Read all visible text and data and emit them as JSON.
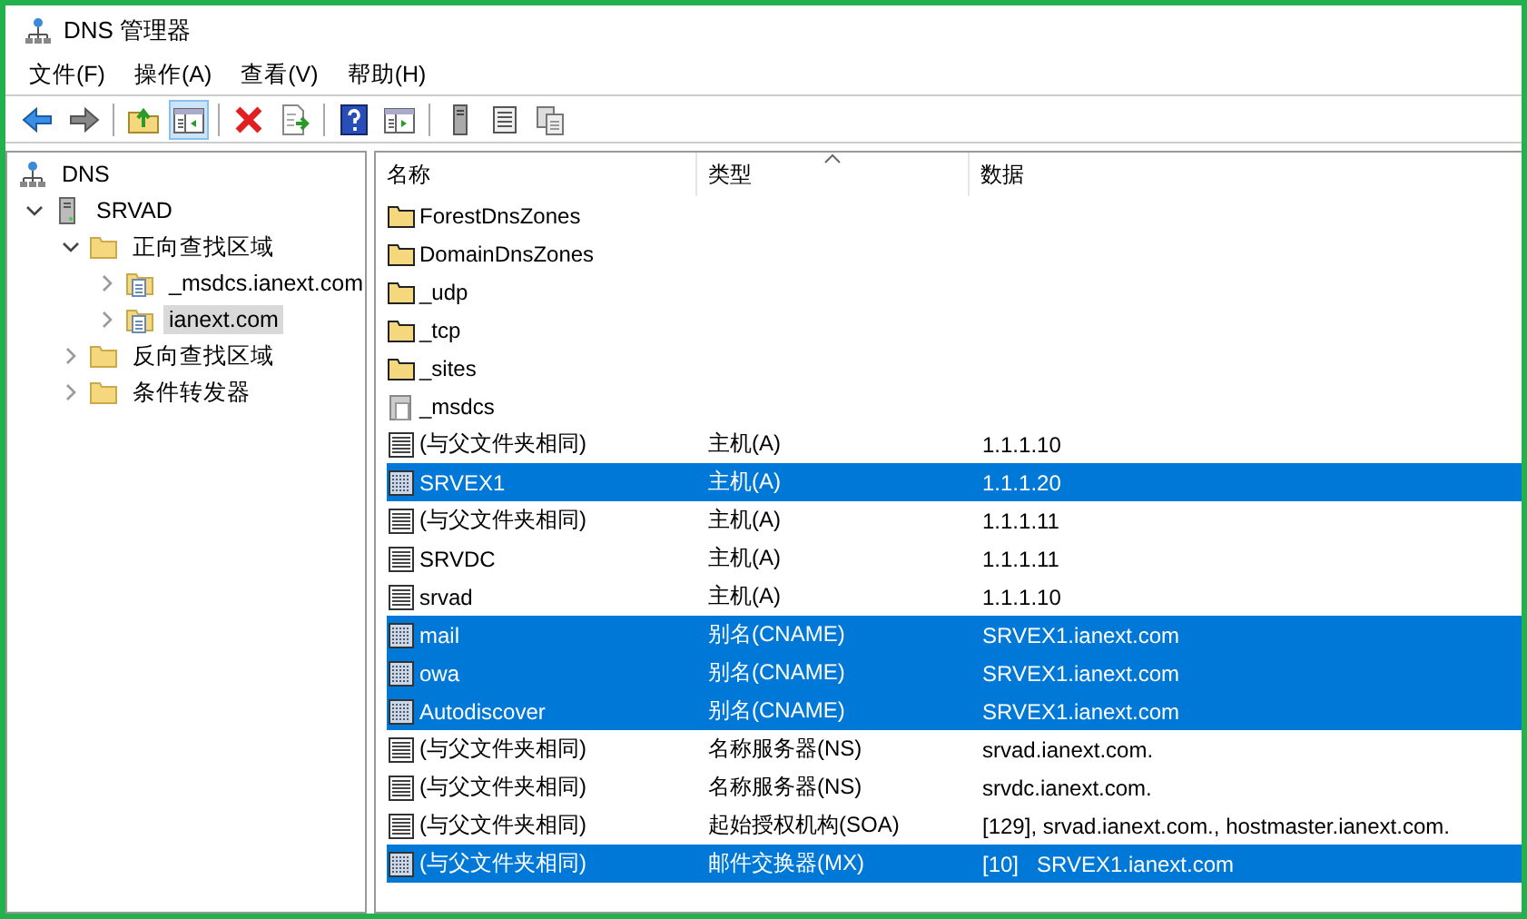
{
  "window": {
    "title": "DNS 管理器"
  },
  "menu": [
    "文件(F)",
    "操作(A)",
    "查看(V)",
    "帮助(H)"
  ],
  "toolbar": [
    {
      "kind": "back",
      "selected": false
    },
    {
      "kind": "forward",
      "selected": false
    },
    {
      "kind": "sep"
    },
    {
      "kind": "up",
      "selected": false
    },
    {
      "kind": "pane",
      "selected": true
    },
    {
      "kind": "sep"
    },
    {
      "kind": "delete",
      "selected": false
    },
    {
      "kind": "export",
      "selected": false
    },
    {
      "kind": "sep"
    },
    {
      "kind": "help",
      "selected": false
    },
    {
      "kind": "panel",
      "selected": false
    },
    {
      "kind": "sep"
    },
    {
      "kind": "server",
      "selected": false
    },
    {
      "kind": "list",
      "selected": false
    },
    {
      "kind": "copy",
      "selected": false
    }
  ],
  "tree": [
    {
      "label": "DNS",
      "kind": "root",
      "selected": false,
      "children": [
        {
          "label": "SRVAD",
          "kind": "server",
          "selected": false,
          "expanded": true,
          "children": [
            {
              "label": "正向查找区域",
              "kind": "folder",
              "selected": false,
              "expanded": true,
              "children": [
                {
                  "label": "_msdcs.ianext.com",
                  "kind": "zone",
                  "selected": false,
                  "expanded": false
                },
                {
                  "label": "ianext.com",
                  "kind": "zone",
                  "selected": true,
                  "expanded": false
                }
              ]
            },
            {
              "label": "反向查找区域",
              "kind": "folder",
              "selected": false,
              "expanded": false
            },
            {
              "label": "条件转发器",
              "kind": "folder",
              "selected": false,
              "expanded": false
            }
          ]
        }
      ]
    }
  ],
  "table": {
    "columns": [
      {
        "label": "名称",
        "sorted": false
      },
      {
        "label": "类型",
        "sorted": true
      },
      {
        "label": "数据",
        "sorted": false
      }
    ],
    "rows": [
      {
        "kind": "folder",
        "name": "ForestDnsZones",
        "selected": false
      },
      {
        "kind": "folder",
        "name": "DomainDnsZones",
        "selected": false
      },
      {
        "kind": "folder",
        "name": "_udp",
        "selected": false
      },
      {
        "kind": "folder",
        "name": "_tcp",
        "selected": false
      },
      {
        "kind": "folder",
        "name": "_sites",
        "selected": false
      },
      {
        "kind": "zone",
        "name": "_msdcs",
        "selected": false
      },
      {
        "kind": "record",
        "name": "(与父文件夹相同)",
        "type": "主机(A)",
        "data": "1.1.1.10",
        "selected": false
      },
      {
        "kind": "record",
        "name": "SRVEX1",
        "type": "主机(A)",
        "data": "1.1.1.20",
        "selected": true
      },
      {
        "kind": "record",
        "name": "(与父文件夹相同)",
        "type": "主机(A)",
        "data": "1.1.1.11",
        "selected": false
      },
      {
        "kind": "record",
        "name": "SRVDC",
        "type": "主机(A)",
        "data": "1.1.1.11",
        "selected": false
      },
      {
        "kind": "record",
        "name": "srvad",
        "type": "主机(A)",
        "data": "1.1.1.10",
        "selected": false
      },
      {
        "kind": "record",
        "name": "mail",
        "type": "别名(CNAME)",
        "data": "SRVEX1.ianext.com",
        "selected": true
      },
      {
        "kind": "record",
        "name": "owa",
        "type": "别名(CNAME)",
        "data": "SRVEX1.ianext.com",
        "selected": true
      },
      {
        "kind": "record",
        "name": "Autodiscover",
        "type": "别名(CNAME)",
        "data": "SRVEX1.ianext.com",
        "selected": true
      },
      {
        "kind": "record",
        "name": "(与父文件夹相同)",
        "type": "名称服务器(NS)",
        "data": "srvad.ianext.com.",
        "selected": false
      },
      {
        "kind": "record",
        "name": "(与父文件夹相同)",
        "type": "名称服务器(NS)",
        "data": "srvdc.ianext.com.",
        "selected": false
      },
      {
        "kind": "record",
        "name": "(与父文件夹相同)",
        "type": "起始授权机构(SOA)",
        "data": "[129], srvad.ianext.com., hostmaster.ianext.com.",
        "selected": false
      },
      {
        "kind": "record",
        "name": "(与父文件夹相同)",
        "type": "邮件交换器(MX)",
        "data": "[10]   SRVEX1.ianext.com",
        "selected": true
      }
    ]
  }
}
